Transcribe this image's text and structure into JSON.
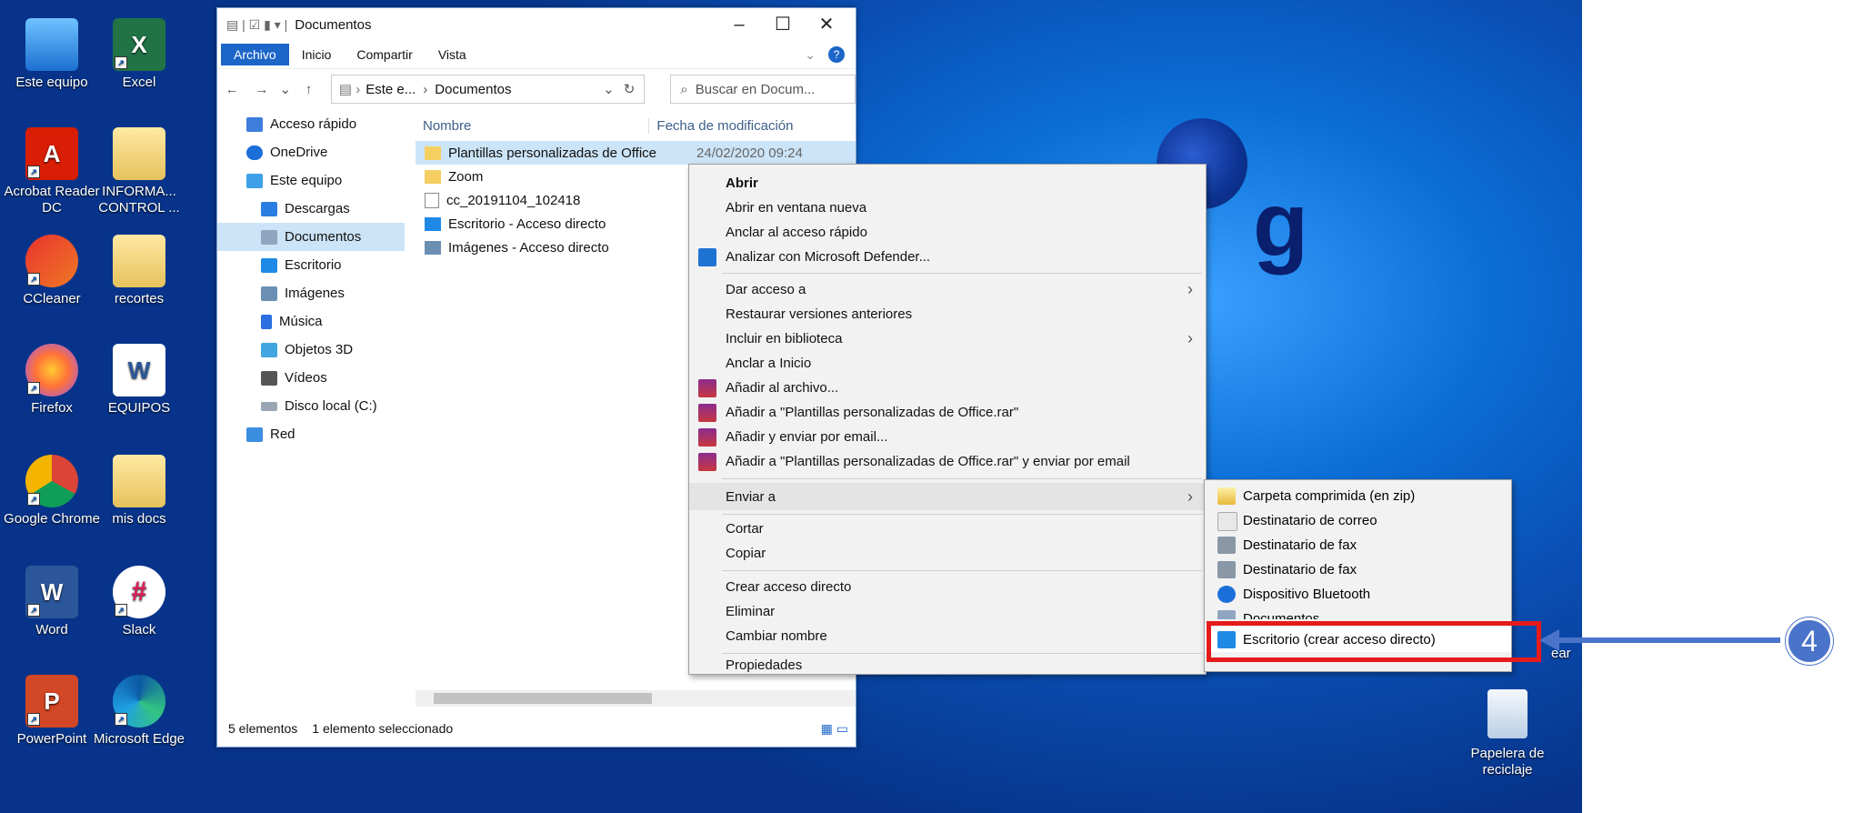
{
  "colors": {
    "accent": "#1c66c8",
    "highlight_box": "#e51b1b",
    "arrow": "#4a74c9",
    "selection": "#cce4f7"
  },
  "desktop": {
    "icons": [
      {
        "label": "Este equipo",
        "icon": "computer-icon"
      },
      {
        "label": "Excel",
        "icon": "excel-icon"
      },
      {
        "label": "Acrobat Reader DC",
        "icon": "acrobat-icon"
      },
      {
        "label": "INFORMA... CONTROL ...",
        "icon": "folder-icon"
      },
      {
        "label": "CCleaner",
        "icon": "ccleaner-icon"
      },
      {
        "label": "recortes",
        "icon": "folder-icon"
      },
      {
        "label": "Firefox",
        "icon": "firefox-icon"
      },
      {
        "label": "EQUIPOS",
        "icon": "word-doc-icon"
      },
      {
        "label": "Google Chrome",
        "icon": "chrome-icon"
      },
      {
        "label": "mis docs",
        "icon": "folder-icon"
      },
      {
        "label": "Word",
        "icon": "word-icon"
      },
      {
        "label": "Slack",
        "icon": "slack-icon"
      },
      {
        "label": "PowerPoint",
        "icon": "powerpoint-icon"
      },
      {
        "label": "Microsoft Edge",
        "icon": "edge-icon"
      }
    ],
    "recycle_bin": "Papelera de reciclaje",
    "partial_label": "ear"
  },
  "explorer": {
    "title": "Documentos",
    "ribbon": {
      "file": "Archivo",
      "home": "Inicio",
      "share": "Compartir",
      "view": "Vista"
    },
    "address": {
      "path_root": "Este e...",
      "path_current": "Documentos",
      "search_placeholder": "Buscar en Docum..."
    },
    "sidebar": [
      {
        "label": "Acceso rápido",
        "icon": "star-icon"
      },
      {
        "label": "OneDrive",
        "icon": "cloud-icon"
      },
      {
        "label": "Este equipo",
        "icon": "computer-icon"
      },
      {
        "label": "Descargas",
        "icon": "download-icon"
      },
      {
        "label": "Documentos",
        "icon": "document-icon"
      },
      {
        "label": "Escritorio",
        "icon": "desktop-icon"
      },
      {
        "label": "Imágenes",
        "icon": "pictures-icon"
      },
      {
        "label": "Música",
        "icon": "music-icon"
      },
      {
        "label": "Objetos 3D",
        "icon": "cube-icon"
      },
      {
        "label": "Vídeos",
        "icon": "video-icon"
      },
      {
        "label": "Disco local (C:)",
        "icon": "drive-icon"
      },
      {
        "label": "Red",
        "icon": "network-icon"
      }
    ],
    "columns": {
      "name": "Nombre",
      "modified": "Fecha de modificación"
    },
    "files": [
      {
        "name": "Plantillas personalizadas de Office",
        "icon": "folder-icon"
      },
      {
        "name": "Zoom",
        "icon": "folder-icon"
      },
      {
        "name": "cc_20191104_102418",
        "icon": "file-icon"
      },
      {
        "name": "Escritorio - Acceso directo",
        "icon": "shortcut-icon"
      },
      {
        "name": "Imágenes - Acceso directo",
        "icon": "shortcut-icon"
      }
    ],
    "first_row_date": "24/02/2020 09:24",
    "status": {
      "count": "5 elementos",
      "selected": "1 elemento seleccionado"
    }
  },
  "context_menu": {
    "items": [
      {
        "label": "Abrir"
      },
      {
        "label": "Abrir en ventana nueva"
      },
      {
        "label": "Anclar al acceso rápido"
      },
      {
        "label": "Analizar con Microsoft Defender...",
        "icon": "defender-icon"
      },
      {
        "label": "Dar acceso a"
      },
      {
        "label": "Restaurar versiones anteriores"
      },
      {
        "label": "Incluir en biblioteca"
      },
      {
        "label": "Anclar a Inicio"
      },
      {
        "label": "Añadir al archivo...",
        "icon": "winrar-icon"
      },
      {
        "label": "Añadir a \"Plantillas personalizadas de Office.rar\"",
        "icon": "winrar-icon"
      },
      {
        "label": "Añadir y enviar por email...",
        "icon": "winrar-icon"
      },
      {
        "label": "Añadir a \"Plantillas personalizadas de Office.rar\" y enviar por email",
        "icon": "winrar-icon"
      },
      {
        "label": "Enviar a"
      },
      {
        "label": "Cortar"
      },
      {
        "label": "Copiar"
      },
      {
        "label": "Crear acceso directo"
      },
      {
        "label": "Eliminar"
      },
      {
        "label": "Cambiar nombre"
      },
      {
        "label": "Propiedades"
      }
    ]
  },
  "send_to_menu": {
    "items": [
      {
        "label": "Carpeta comprimida (en zip)",
        "icon": "zip-folder-icon"
      },
      {
        "label": "Destinatario de correo",
        "icon": "mail-icon"
      },
      {
        "label": "Destinatario de fax",
        "icon": "fax-icon"
      },
      {
        "label": "Destinatario de fax",
        "icon": "fax-icon"
      },
      {
        "label": "Dispositivo Bluetooth",
        "icon": "bluetooth-icon"
      },
      {
        "label": "Documentos",
        "icon": "document-icon"
      },
      {
        "label": "Escritorio (crear acceso directo)",
        "icon": "desktop-icon"
      }
    ]
  },
  "annotation": {
    "step_number": "4"
  }
}
